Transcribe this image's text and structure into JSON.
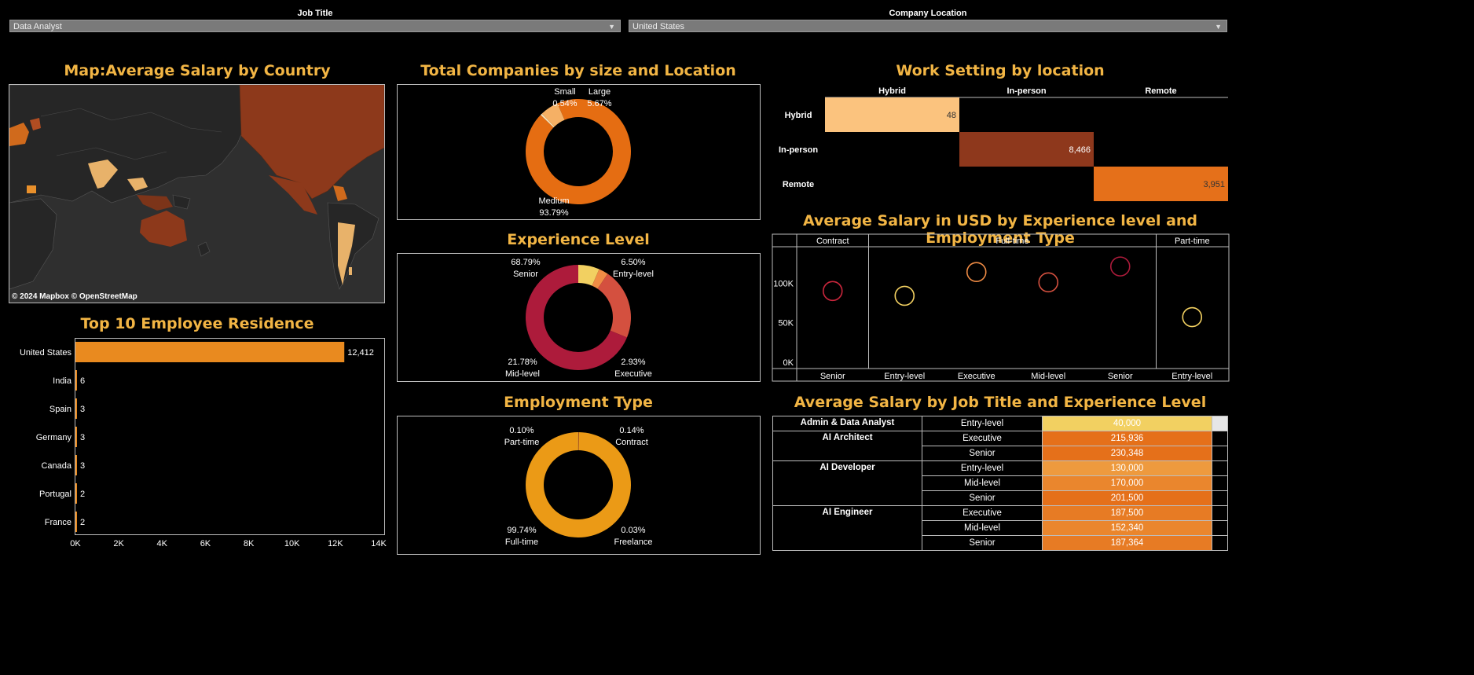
{
  "filters": {
    "job_title": {
      "label": "Job Title",
      "value": "Data Analyst"
    },
    "company_location": {
      "label": "Company Location",
      "value": "United States"
    }
  },
  "map": {
    "title": "Map:Average Salary by Country",
    "attribution": "© 2024 Mapbox  © OpenStreetMap"
  },
  "residence": {
    "title": "Top 10 Employee Residence",
    "chart_data": {
      "type": "bar",
      "categories": [
        "United States",
        "India",
        "Spain",
        "Germany",
        "Canada",
        "Portugal",
        "France"
      ],
      "values": [
        12412,
        6,
        3,
        3,
        3,
        2,
        2
      ],
      "value_labels": [
        "12,412",
        "6",
        "3",
        "3",
        "3",
        "2",
        "2"
      ],
      "ticks": [
        "0K",
        "2K",
        "4K",
        "6K",
        "8K",
        "10K",
        "12K",
        "14K"
      ],
      "xlim": [
        0,
        14000
      ],
      "bar_color": "#e98a1f"
    }
  },
  "company_size": {
    "title": "Total Companies by size and Location",
    "chart_data": {
      "type": "pie",
      "slices": [
        {
          "label": "Medium",
          "pct_label": "93.79%",
          "value": 93.79,
          "color": "#e56d12"
        },
        {
          "label": "Small",
          "pct_label": "0.54%",
          "value": 0.54,
          "color": "#fbe1b5"
        },
        {
          "label": "Large",
          "pct_label": "5.67%",
          "value": 5.67,
          "color": "#f5b065"
        }
      ]
    }
  },
  "experience": {
    "title": "Experience Level",
    "chart_data": {
      "type": "pie",
      "slices": [
        {
          "label": "Entry-level",
          "pct_label": "6.50%",
          "value": 6.5,
          "color": "#f2d061"
        },
        {
          "label": "Executive",
          "pct_label": "2.93%",
          "value": 2.93,
          "color": "#f08c45"
        },
        {
          "label": "Mid-level",
          "pct_label": "21.78%",
          "value": 21.78,
          "color": "#d4503f"
        },
        {
          "label": "Senior",
          "pct_label": "68.79%",
          "value": 68.79,
          "color": "#ad1b3b"
        }
      ]
    }
  },
  "employment": {
    "title": "Employment Type",
    "chart_data": {
      "type": "pie",
      "slices": [
        {
          "label": "Contract",
          "pct_label": "0.14%",
          "value": 0.14,
          "color": "#a3321e"
        },
        {
          "label": "Freelance",
          "pct_label": "0.03%",
          "value": 0.03,
          "color": "#c9620b"
        },
        {
          "label": "Full-time",
          "pct_label": "99.74%",
          "value": 99.74,
          "color": "#eb9a16"
        },
        {
          "label": "Part-time",
          "pct_label": "0.10%",
          "value": 0.1,
          "color": "#f0c15e"
        }
      ]
    }
  },
  "work_setting": {
    "title": "Work Setting by location",
    "chart_data": {
      "type": "heatmap",
      "columns": [
        "Hybrid",
        "In-person",
        "Remote"
      ],
      "rows": [
        "Hybrid",
        "In-person",
        "Remote"
      ],
      "cells": [
        {
          "row": "Hybrid",
          "col": "Hybrid",
          "label": "48",
          "value": 48,
          "color": "#fbc37e"
        },
        {
          "row": "In-person",
          "col": "In-person",
          "label": "8,466",
          "value": 8466,
          "color": "#8e381c"
        },
        {
          "row": "Remote",
          "col": "Remote",
          "label": "3,951",
          "value": 3951,
          "color": "#e5701a"
        }
      ]
    }
  },
  "salary_scatter": {
    "title": "Average Salary in USD by Experience level and Employment Type",
    "chart_data": {
      "type": "scatter",
      "groups": [
        {
          "name": "Contract",
          "categories": [
            "Senior"
          ]
        },
        {
          "name": "Full-time",
          "categories": [
            "Entry-level",
            "Executive",
            "Mid-level",
            "Senior"
          ]
        },
        {
          "name": "Part-time",
          "categories": [
            "Entry-level"
          ]
        }
      ],
      "y_ticks": [
        "0K",
        "50K",
        "100K"
      ],
      "ylim": [
        0,
        140000
      ],
      "points": [
        {
          "group": "Contract",
          "category": "Senior",
          "value": 90000,
          "color": "#c9263c"
        },
        {
          "group": "Full-time",
          "category": "Entry-level",
          "value": 84000,
          "color": "#f2d061"
        },
        {
          "group": "Full-time",
          "category": "Executive",
          "value": 114000,
          "color": "#f08c45"
        },
        {
          "group": "Full-time",
          "category": "Mid-level",
          "value": 101000,
          "color": "#d4503f"
        },
        {
          "group": "Full-time",
          "category": "Senior",
          "value": 121000,
          "color": "#ad1b3b"
        },
        {
          "group": "Part-time",
          "category": "Entry-level",
          "value": 57000,
          "color": "#f2d061"
        }
      ]
    }
  },
  "job_table": {
    "title": "Average Salary by Job Title and Experience Level",
    "chart_data": {
      "type": "table",
      "groups": [
        {
          "title": "Admin & Data Analyst",
          "rows": [
            {
              "level": "Entry-level",
              "value_label": "40,000",
              "value": 40000,
              "color": "#f2d061"
            }
          ]
        },
        {
          "title": "AI Architect",
          "rows": [
            {
              "level": "Executive",
              "value_label": "215,936",
              "value": 215936,
              "color": "#e5701a"
            },
            {
              "level": "Senior",
              "value_label": "230,348",
              "value": 230348,
              "color": "#e5701a"
            }
          ]
        },
        {
          "title": "AI Developer",
          "rows": [
            {
              "level": "Entry-level",
              "value_label": "130,000",
              "value": 130000,
              "color": "#ee9a3e"
            },
            {
              "level": "Mid-level",
              "value_label": "170,000",
              "value": 170000,
              "color": "#ea862d"
            },
            {
              "level": "Senior",
              "value_label": "201,500",
              "value": 201500,
              "color": "#e5701a"
            }
          ]
        },
        {
          "title": "AI Engineer",
          "rows": [
            {
              "level": "Executive",
              "value_label": "187,500",
              "value": 187500,
              "color": "#e77b24"
            },
            {
              "level": "Mid-level",
              "value_label": "152,340",
              "value": 152340,
              "color": "#ea862d"
            },
            {
              "level": "Senior",
              "value_label": "187,364",
              "value": 187364,
              "color": "#e77b24"
            }
          ]
        }
      ]
    }
  }
}
